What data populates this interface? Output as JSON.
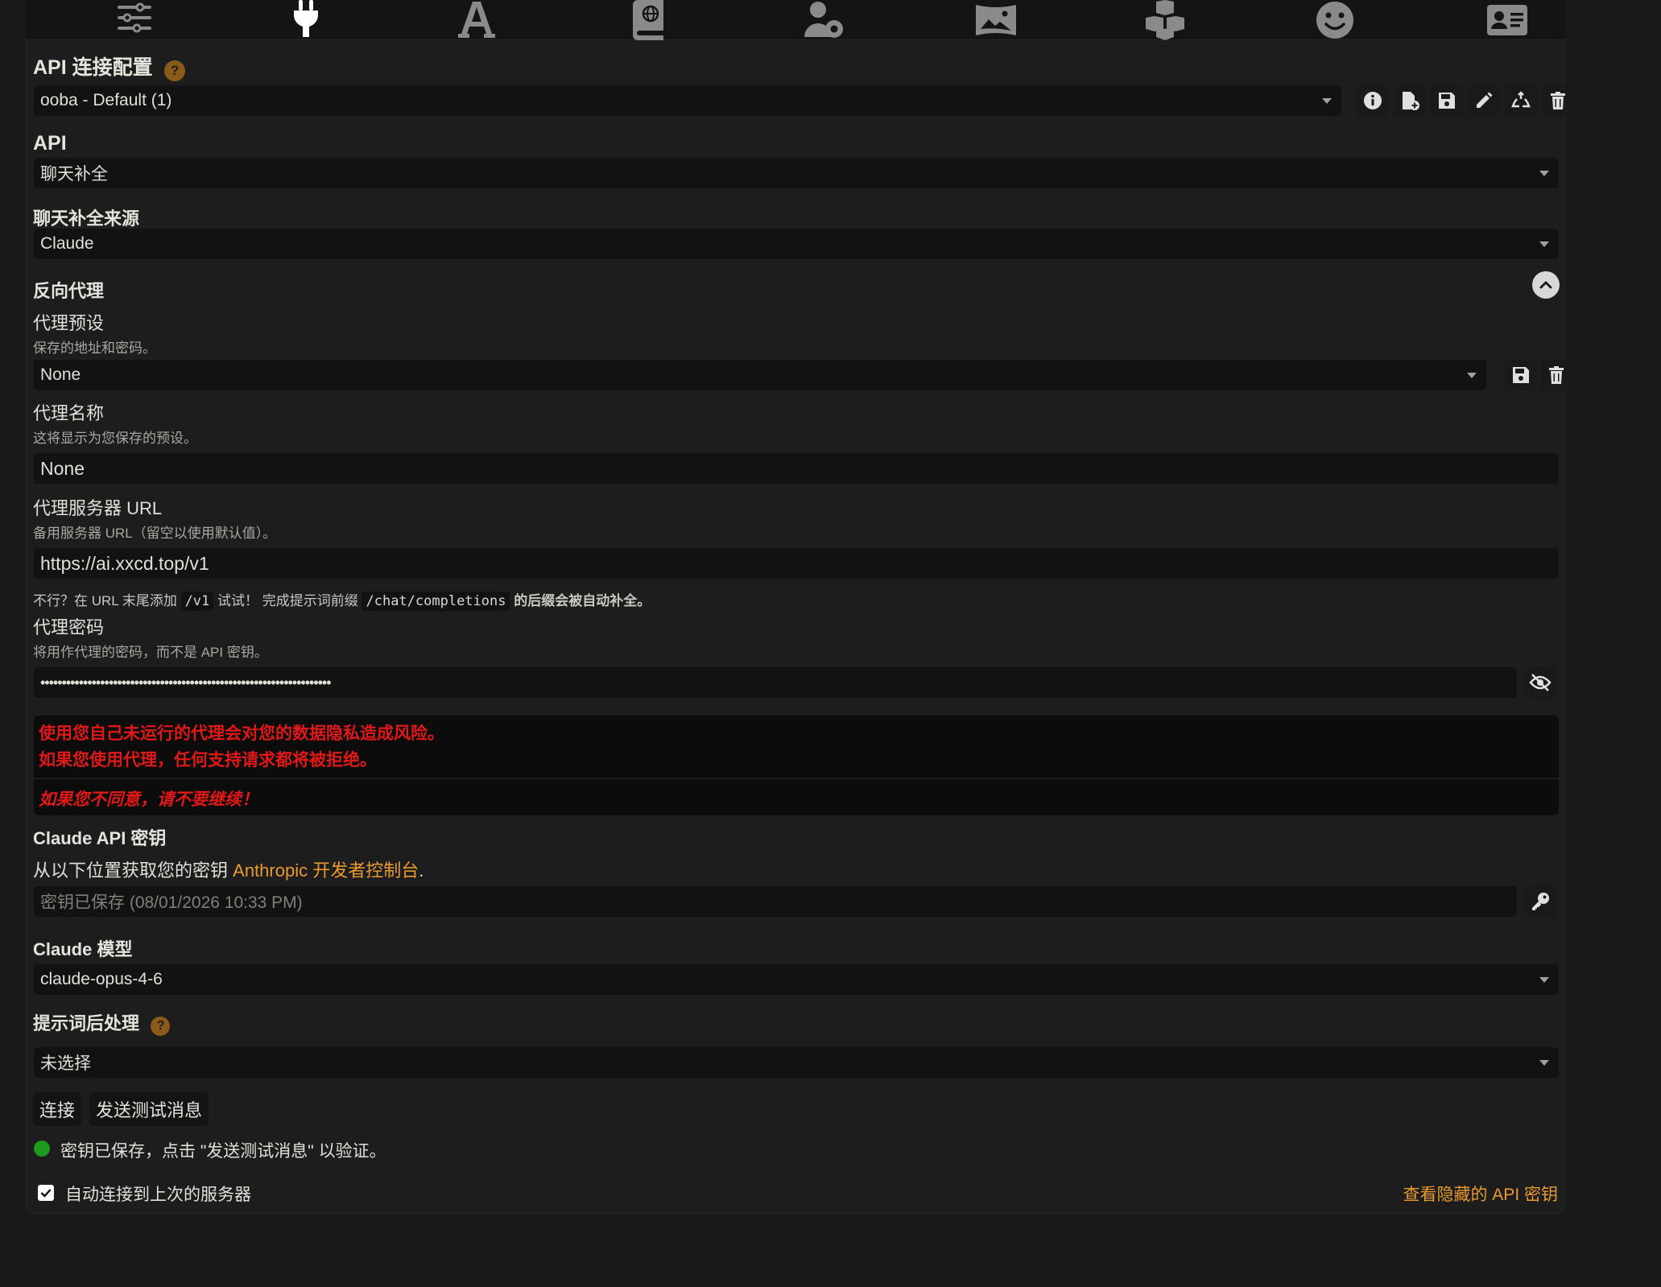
{
  "topbar": {
    "icons": [
      "sliders-icon",
      "plug-icon",
      "font-icon",
      "book-globe-icon",
      "user-cog-icon",
      "image-icon",
      "cubes-icon",
      "smile-icon",
      "id-card-icon"
    ],
    "active_color": "#ffffff",
    "inactive_color": "#8a8a8a"
  },
  "connection_profile": {
    "title": "API 连接配置",
    "help": "?",
    "selected": "ooba - Default (1)"
  },
  "api": {
    "title": "API",
    "selected": "聊天补全"
  },
  "chat_source": {
    "title": "聊天补全来源",
    "selected": "Claude"
  },
  "reverse_proxy": {
    "title": "反向代理",
    "preset": {
      "label": "代理预设",
      "hint": "保存的地址和密码。",
      "selected": "None"
    },
    "name": {
      "label": "代理名称",
      "hint": "这将显示为您保存的预设。",
      "value": "None"
    },
    "url": {
      "label": "代理服务器 URL",
      "hint": "备用服务器 URL（留空以使用默认值）。",
      "value": "https://ai.xxcd.top/v1",
      "note_prefix": "不行？在 URL 末尾添加",
      "note_code1": "/v1",
      "note_mid": "试试！ 完成提示词前缀",
      "note_code2": "/chat/completions",
      "note_suffix": "的后缀会被自动补全。"
    },
    "password": {
      "label": "代理密码",
      "hint": "将用作代理的密码，而不是 API 密钥。",
      "value": "••••••••••••••••••••••••••••••••••••••••••••••••••••••••••••••••••••"
    },
    "warning": {
      "line1": "使用您自己未运行的代理会对您的数据隐私造成风险。",
      "line2": "如果您使用代理，任何支持请求都将被拒绝。",
      "line3": "如果您不同意，请不要继续！",
      "color": "#e11818"
    }
  },
  "claude_key": {
    "title": "Claude API 密钥",
    "desc_prefix": "从以下位置获取您的密钥",
    "desc_link": "Anthropic 开发者控制台",
    "desc_suffix": ".",
    "placeholder": "密钥已保存 (08/01/2026 10:33 PM)"
  },
  "claude_model": {
    "title": "Claude 模型",
    "selected": "claude-opus-4-6"
  },
  "post_processing": {
    "title": "提示词后处理",
    "help": "?",
    "selected": "未选择"
  },
  "actions": {
    "connect": "连接",
    "send_test": "发送测试消息"
  },
  "status": {
    "text": "密钥已保存，点击 \"发送测试消息\" 以验证。",
    "dot_color": "#1f9a1f"
  },
  "auto_connect": {
    "label": "自动连接到上次的服务器",
    "checked": true
  },
  "hidden_keys_link": "查看隐藏的 API 密钥",
  "accent_color": "#e99a2e"
}
